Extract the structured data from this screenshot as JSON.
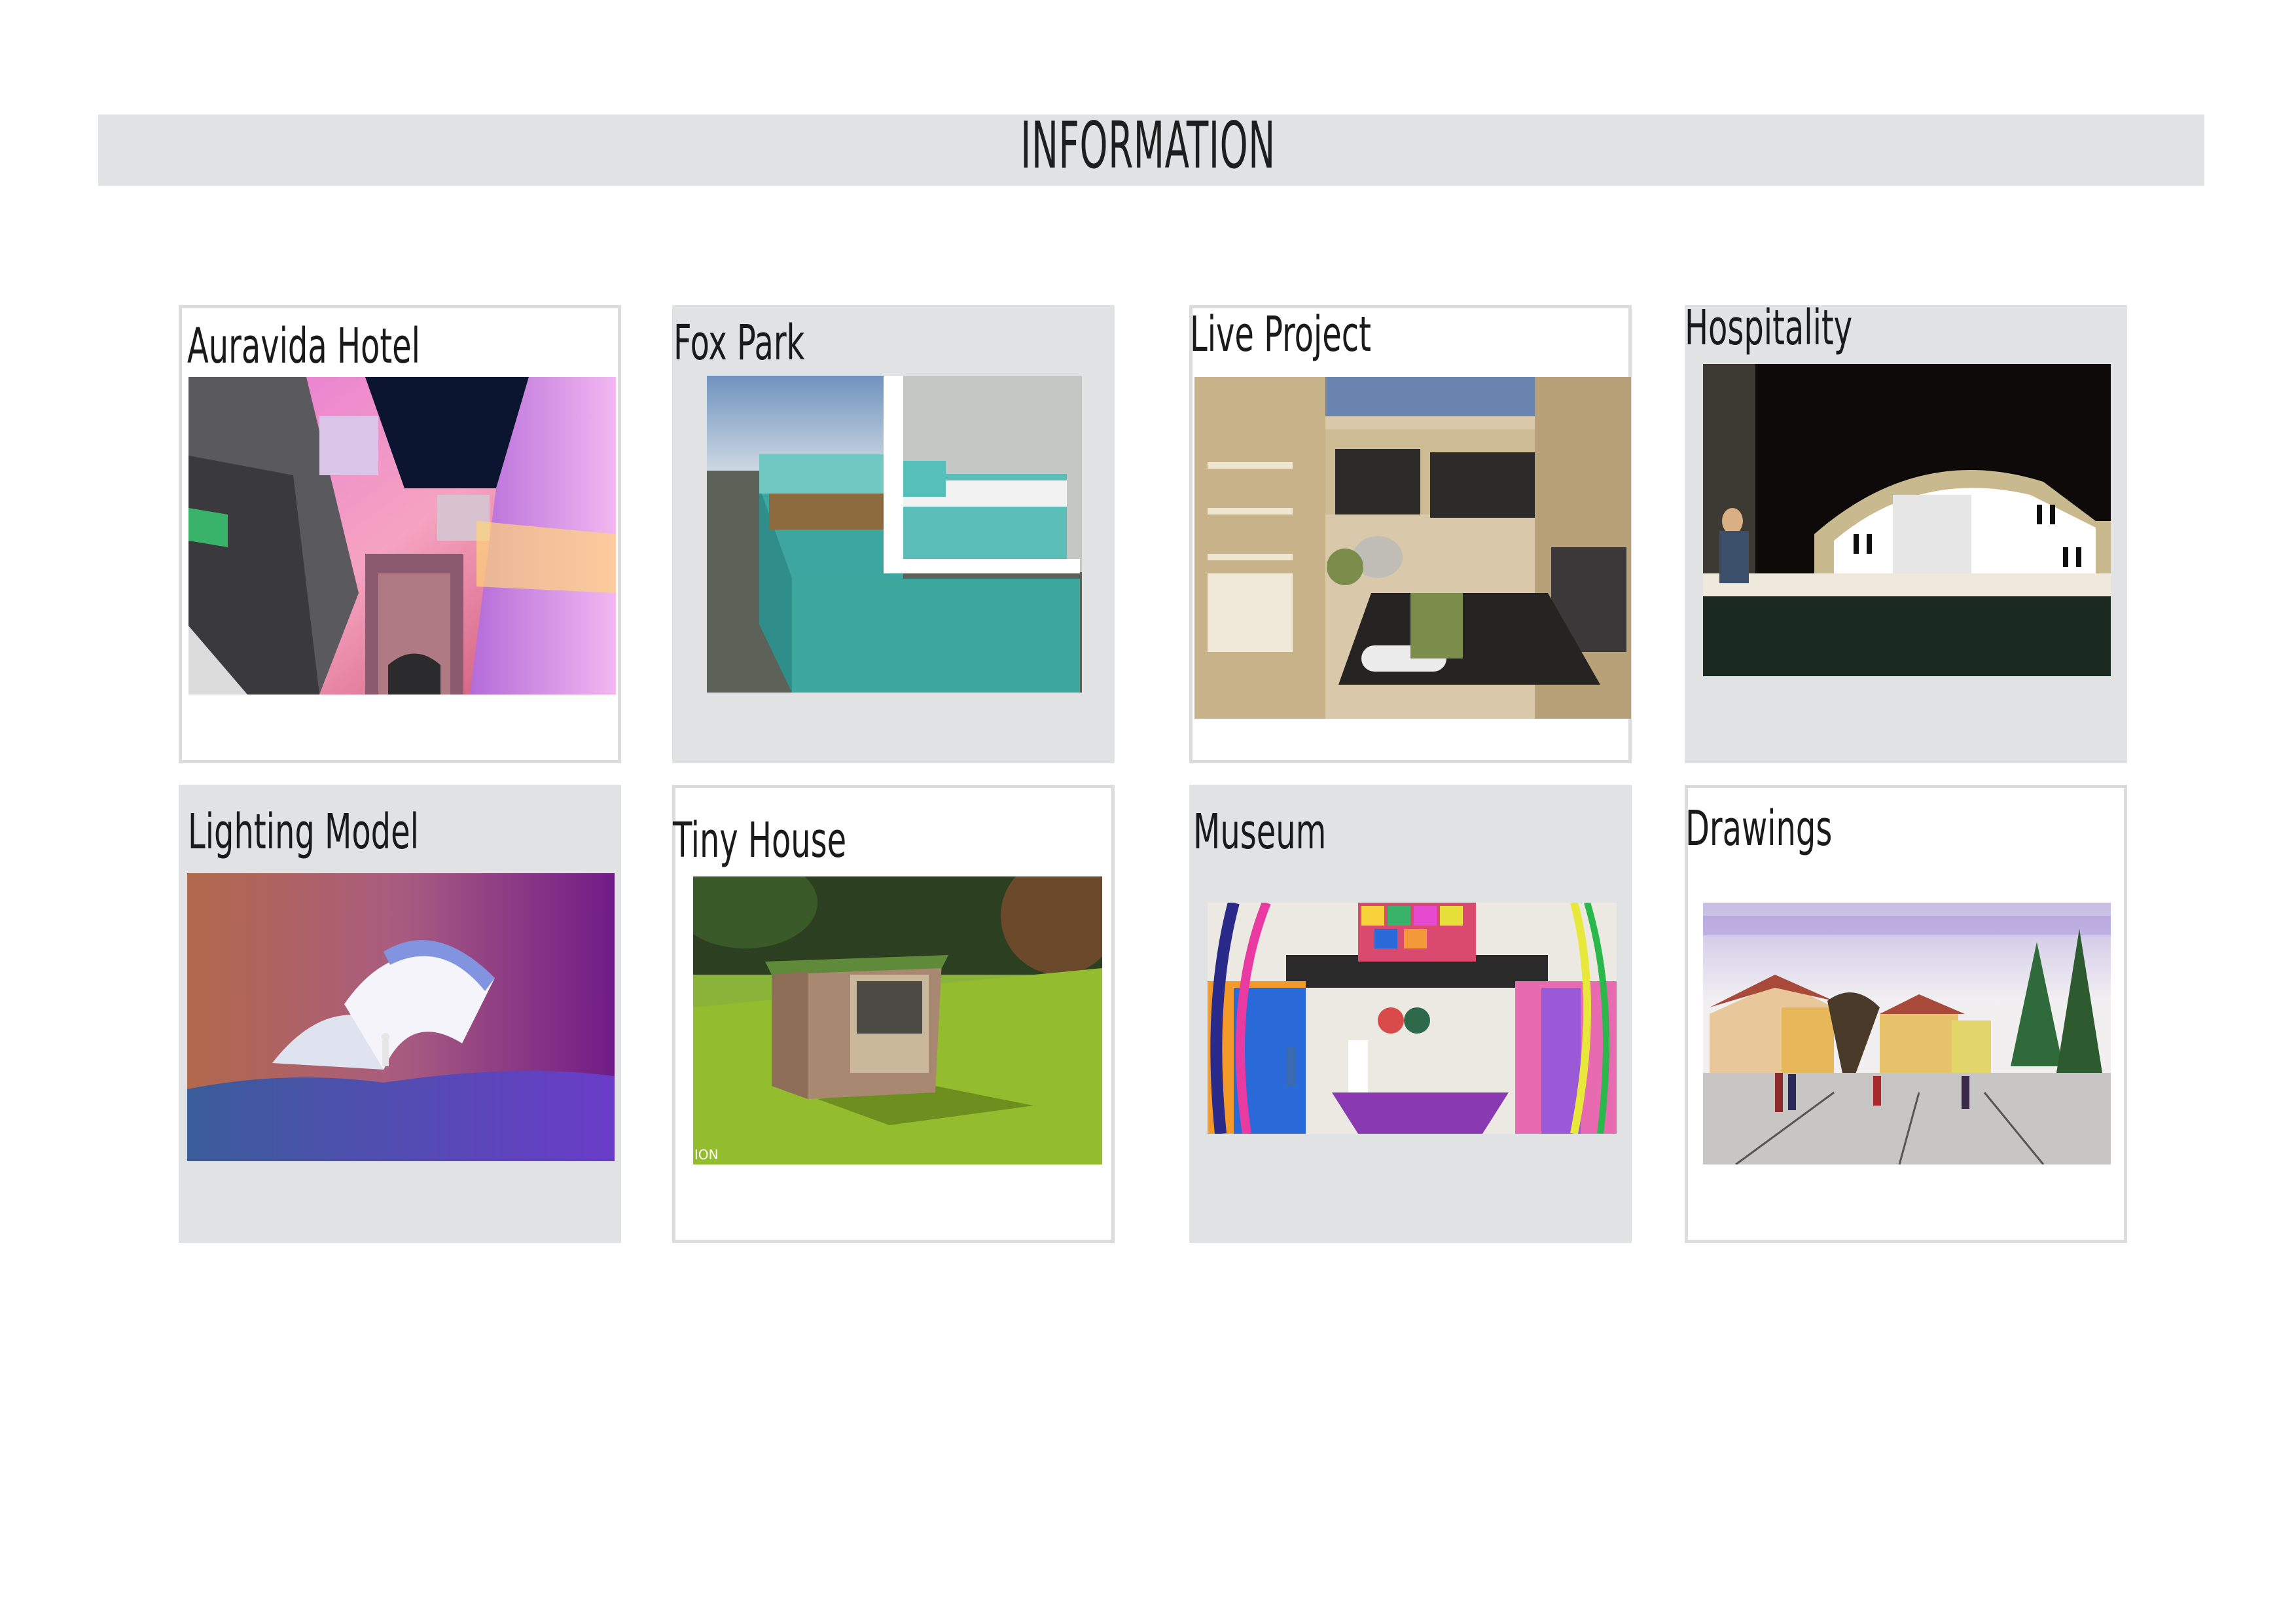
{
  "page": {
    "title": "INFORMATION"
  },
  "cards": [
    {
      "title": "Auravida Hotel",
      "image": "hotel-atrium-render"
    },
    {
      "title": "Fox Park",
      "image": "rooftop-building-render"
    },
    {
      "title": "Live Project",
      "image": "yoga-studio-render"
    },
    {
      "title": "Hospitality",
      "image": "bar-interior-render"
    },
    {
      "title": "Lighting Model",
      "image": "lighting-model-photo"
    },
    {
      "title": "Tiny House",
      "image": "tiny-house-render",
      "caption": "ION"
    },
    {
      "title": "Museum",
      "image": "museum-gallery-render"
    },
    {
      "title": "Drawings",
      "image": "watercolor-drawing"
    }
  ]
}
